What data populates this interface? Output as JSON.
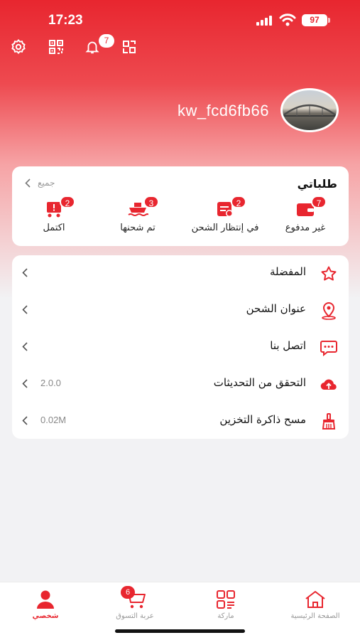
{
  "status_bar": {
    "time": "17:23",
    "battery": "97"
  },
  "top_icons": {
    "notification_count": "7"
  },
  "profile": {
    "username": "kw_fcd6fb66"
  },
  "orders": {
    "title": "طلباتي",
    "view_all": "جميع",
    "tabs": [
      {
        "label": "غير مدفوع",
        "count": "7",
        "icon": "wallet-icon"
      },
      {
        "label": "في إنتظار الشحن",
        "count": "2",
        "icon": "waiting-shipment-icon"
      },
      {
        "label": "تم شحنها",
        "count": "3",
        "icon": "ship-icon"
      },
      {
        "label": "اكتمل",
        "count": "2",
        "icon": "completed-cart-icon"
      }
    ]
  },
  "menu": [
    {
      "label": "المفضلة",
      "value": "",
      "icon": "star-icon"
    },
    {
      "label": "عنوان الشحن",
      "value": "",
      "icon": "location-pin-icon"
    },
    {
      "label": "اتصل بنا",
      "value": "",
      "icon": "chat-icon"
    },
    {
      "label": "التحقق من التحديثات",
      "value": "2.0.0",
      "icon": "cloud-upload-icon"
    },
    {
      "label": "مسح ذاكرة التخزين",
      "value": "0.02M",
      "icon": "broom-icon"
    }
  ],
  "tabbar": {
    "items": [
      {
        "label": "الصفحة الرئيسية",
        "icon": "home-icon"
      },
      {
        "label": "ماركة",
        "icon": "brand-grid-icon"
      },
      {
        "label": "عربة التسوق",
        "icon": "cart-icon",
        "badge": "6"
      },
      {
        "label": "شخصي",
        "icon": "person-icon"
      }
    ],
    "active": "شخصي"
  },
  "colors": {
    "accent": "#e8262f",
    "background": "#f2f2f4"
  }
}
